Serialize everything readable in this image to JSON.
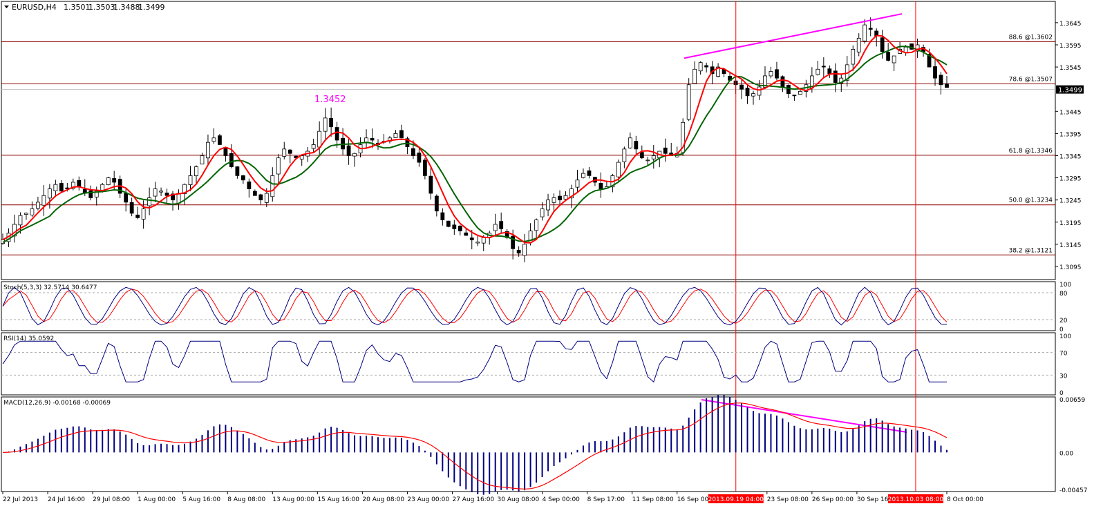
{
  "header": {
    "symbol": "EURUSD,H4",
    "open": "1.3501",
    "high": "1.3503",
    "low": "1.3488",
    "close": "1.3499"
  },
  "colors": {
    "candle": "#000000",
    "ma_fast": "#ff0000",
    "ma_slow": "#006400",
    "ma_flip": "#ffff00",
    "fib_line": "#8b0000",
    "vline": "#ff0000",
    "trendline": "#ff00ff",
    "stoch_main": "#000080",
    "stoch_signal": "#ff0000",
    "rsi": "#000080",
    "macd_hist": "#000080",
    "macd_signal": "#ff0000",
    "highlight_label": "#ff0000"
  },
  "chart_data": {
    "type": "candlestick",
    "symbol": "EURUSD",
    "timeframe": "H4",
    "ylim": [
      1.307,
      1.369
    ],
    "price_ticks": [
      "1.3645",
      "1.3595",
      "1.3545",
      "1.3445",
      "1.3395",
      "1.3345",
      "1.3295",
      "1.3245",
      "1.3195",
      "1.3145",
      "1.3095"
    ],
    "current_price": "1.3499",
    "annotation": {
      "text": "1.3452",
      "color": "#ff00ff"
    },
    "fib_levels": [
      {
        "label": "88.6 @1.3602",
        "value": 1.3602
      },
      {
        "label": "78.6 @1.3507",
        "value": 1.3507
      },
      {
        "label": "61.8 @1.3346",
        "value": 1.3346
      },
      {
        "label": "50.0 @1.3234",
        "value": 1.3234
      },
      {
        "label": "38.2 @1.3121",
        "value": 1.3121
      }
    ],
    "x_labels": [
      "22 Jul 2013",
      "24 Jul 16:00",
      "29 Jul 08:00",
      "1 Aug 00:00",
      "5 Aug 16:00",
      "8 Aug 08:00",
      "13 Aug 00:00",
      "15 Aug 16:00",
      "20 Aug 08:00",
      "23 Aug 00:00",
      "27 Aug 16:00",
      "30 Aug 08:00",
      "4 Sep 00:00",
      "8 Sep 17:00",
      "11 Sep 08:00",
      "16 Sep 00:00",
      "2013.09.19 04:00",
      "23 Sep 08:00",
      "26 Sep 00:00",
      "30 Sep 16:00",
      "2013.10.03 08:00",
      "8 Oct 00:00"
    ],
    "highlight_times": [
      "2013.09.19 04:00",
      "2013.10.03 08:00"
    ],
    "closes": [
      1.3155,
      1.317,
      1.319,
      1.321,
      1.3215,
      1.3225,
      1.324,
      1.3255,
      1.327,
      1.328,
      1.3265,
      1.327,
      1.3285,
      1.3275,
      1.326,
      1.325,
      1.3265,
      1.328,
      1.3295,
      1.3285,
      1.326,
      1.324,
      1.3215,
      1.3205,
      1.3225,
      1.325,
      1.327,
      1.3265,
      1.3255,
      1.3245,
      1.326,
      1.328,
      1.33,
      1.332,
      1.3345,
      1.3375,
      1.3385,
      1.337,
      1.3345,
      1.332,
      1.33,
      1.329,
      1.327,
      1.3255,
      1.3245,
      1.326,
      1.33,
      1.334,
      1.336,
      1.335,
      1.334,
      1.3345,
      1.3355,
      1.337,
      1.34,
      1.343,
      1.341,
      1.338,
      1.336,
      1.3345,
      1.335,
      1.337,
      1.3385,
      1.338,
      1.337,
      1.3375,
      1.3385,
      1.3395,
      1.3385,
      1.3365,
      1.3345,
      1.333,
      1.33,
      1.326,
      1.322,
      1.32,
      1.3185,
      1.318,
      1.3175,
      1.3165,
      1.3155,
      1.315,
      1.316,
      1.317,
      1.319,
      1.318,
      1.316,
      1.3135,
      1.3125,
      1.3145,
      1.3175,
      1.32,
      1.3225,
      1.3245,
      1.325,
      1.3245,
      1.3255,
      1.327,
      1.329,
      1.3305,
      1.33,
      1.3285,
      1.327,
      1.3275,
      1.33,
      1.333,
      1.336,
      1.3385,
      1.336,
      1.334,
      1.3335,
      1.3345,
      1.3355,
      1.335,
      1.3345,
      1.335,
      1.342,
      1.3505,
      1.354,
      1.3555,
      1.3545,
      1.353,
      1.3545,
      1.353,
      1.3515,
      1.3505,
      1.3495,
      1.348,
      1.3485,
      1.35,
      1.3525,
      1.3535,
      1.352,
      1.35,
      1.3485,
      1.348,
      1.349,
      1.3505,
      1.3525,
      1.354,
      1.3545,
      1.353,
      1.351,
      1.352,
      1.355,
      1.3585,
      1.361,
      1.364,
      1.363,
      1.3615,
      1.358,
      1.356,
      1.357,
      1.3585,
      1.359,
      1.3585,
      1.3595,
      1.358,
      1.3545,
      1.352,
      1.3505,
      1.3499
    ],
    "stoch_ticks": [
      "100",
      "80",
      "20",
      "0"
    ],
    "rsi_ticks": [
      "100",
      "70",
      "30",
      "0"
    ],
    "macd_ticks": [
      "0.00659",
      "0.00",
      "-0.00457"
    ]
  },
  "panels": {
    "stoch": {
      "label": "Stoch(5,3,3) 32.5714 30.6477"
    },
    "rsi": {
      "label": "RSI(14) 35.0592"
    },
    "macd": {
      "label": "MACD(12,26,9) -0.00168 -0.00069"
    }
  }
}
